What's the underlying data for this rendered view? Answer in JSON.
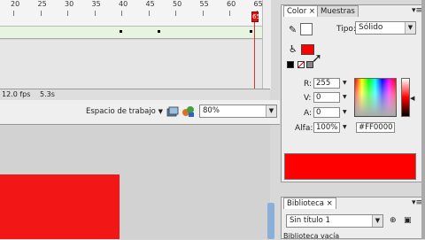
{
  "timeline": {
    "ruler_numbers": [
      "20",
      "25",
      "30",
      "35",
      "40",
      "45",
      "50",
      "55",
      "60",
      "65"
    ],
    "playhead_frame": "65"
  },
  "status": {
    "fps": "12.0 fps",
    "time": "5.3s"
  },
  "toolbar": {
    "workspace_label": "Espacio de trabajo",
    "zoom_value": "80%"
  },
  "color_panel": {
    "tab_color": "Color",
    "tab_swatches": "Muestras",
    "close_glyph": "×",
    "type_label": "Tipo:",
    "type_value": "Sólido",
    "fields": [
      {
        "label": "R:",
        "value": "255"
      },
      {
        "label": "V:",
        "value": "0"
      },
      {
        "label": "A:",
        "value": "0"
      },
      {
        "label": "Alfa:",
        "value": "100%"
      }
    ],
    "hex_value": "#FF0000",
    "fill_color": "#FF0000"
  },
  "library_panel": {
    "tab_label": "Biblioteca",
    "close_glyph": "×",
    "document_value": "Sin título 1",
    "empty_text": "Biblioteca vacía"
  },
  "stage": {
    "shape_color": "#F21616"
  }
}
